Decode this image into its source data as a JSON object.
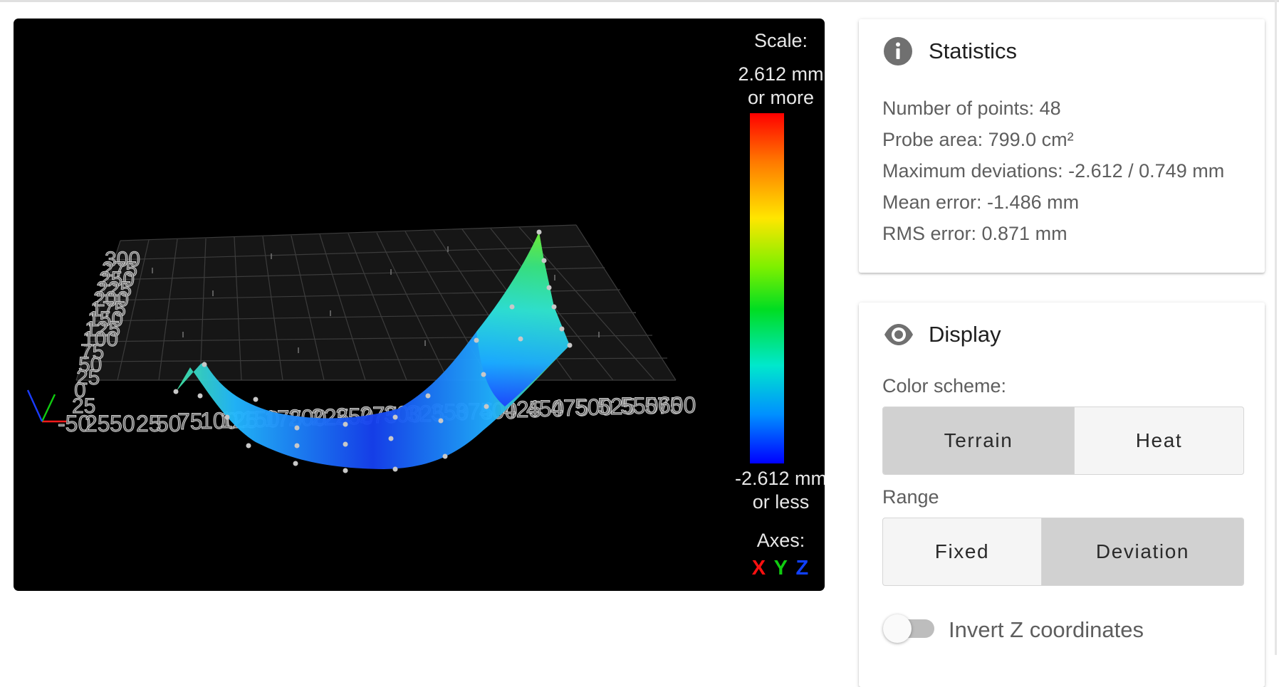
{
  "viewer": {
    "scale_title": "Scale:",
    "scale_max_value": "2.612 mm",
    "scale_max_note": "or more",
    "scale_min_value": "-2.612 mm",
    "scale_min_note": "or less",
    "axes_title": "Axes:",
    "axis_x": "X",
    "axis_y": "Y",
    "axis_z": "Z",
    "grid_x_ticks": [
      "-50",
      "0",
      "25",
      "50",
      "75",
      "100",
      "125",
      "150",
      "175",
      "200",
      "225",
      "250",
      "275",
      "300",
      "325",
      "350",
      "375",
      "400",
      "425",
      "450",
      "475",
      "500",
      "525",
      "550",
      "575",
      "600"
    ],
    "grid_y_ticks": [
      "0",
      "25",
      "50",
      "75",
      "100",
      "125",
      "150",
      "175",
      "200",
      "225",
      "250",
      "275",
      "300"
    ]
  },
  "statistics": {
    "title": "Statistics",
    "icon": "info-icon",
    "points": "Number of points: 48",
    "probe_area": "Probe area: 799.0 cm²",
    "max_dev": "Maximum deviations: -2.612 / 0.749 mm",
    "mean_error": "Mean error: -1.486 mm",
    "rms_error": "RMS error: 0.871 mm"
  },
  "display": {
    "title": "Display",
    "icon": "eye-icon",
    "color_scheme_label": "Color scheme:",
    "color_scheme_options": [
      "Terrain",
      "Heat"
    ],
    "color_scheme_selected": "Terrain",
    "range_label": "Range",
    "range_options": [
      "Fixed",
      "Deviation"
    ],
    "range_selected": "Deviation",
    "invert_z_label": "Invert Z coordinates",
    "invert_z_checked": false
  },
  "colors": {
    "active_button": "#d1d1d1",
    "inactive_button": "#f5f5f5",
    "axis_x": "#ff1010",
    "axis_y": "#10cc10",
    "axis_z": "#1040ff"
  }
}
